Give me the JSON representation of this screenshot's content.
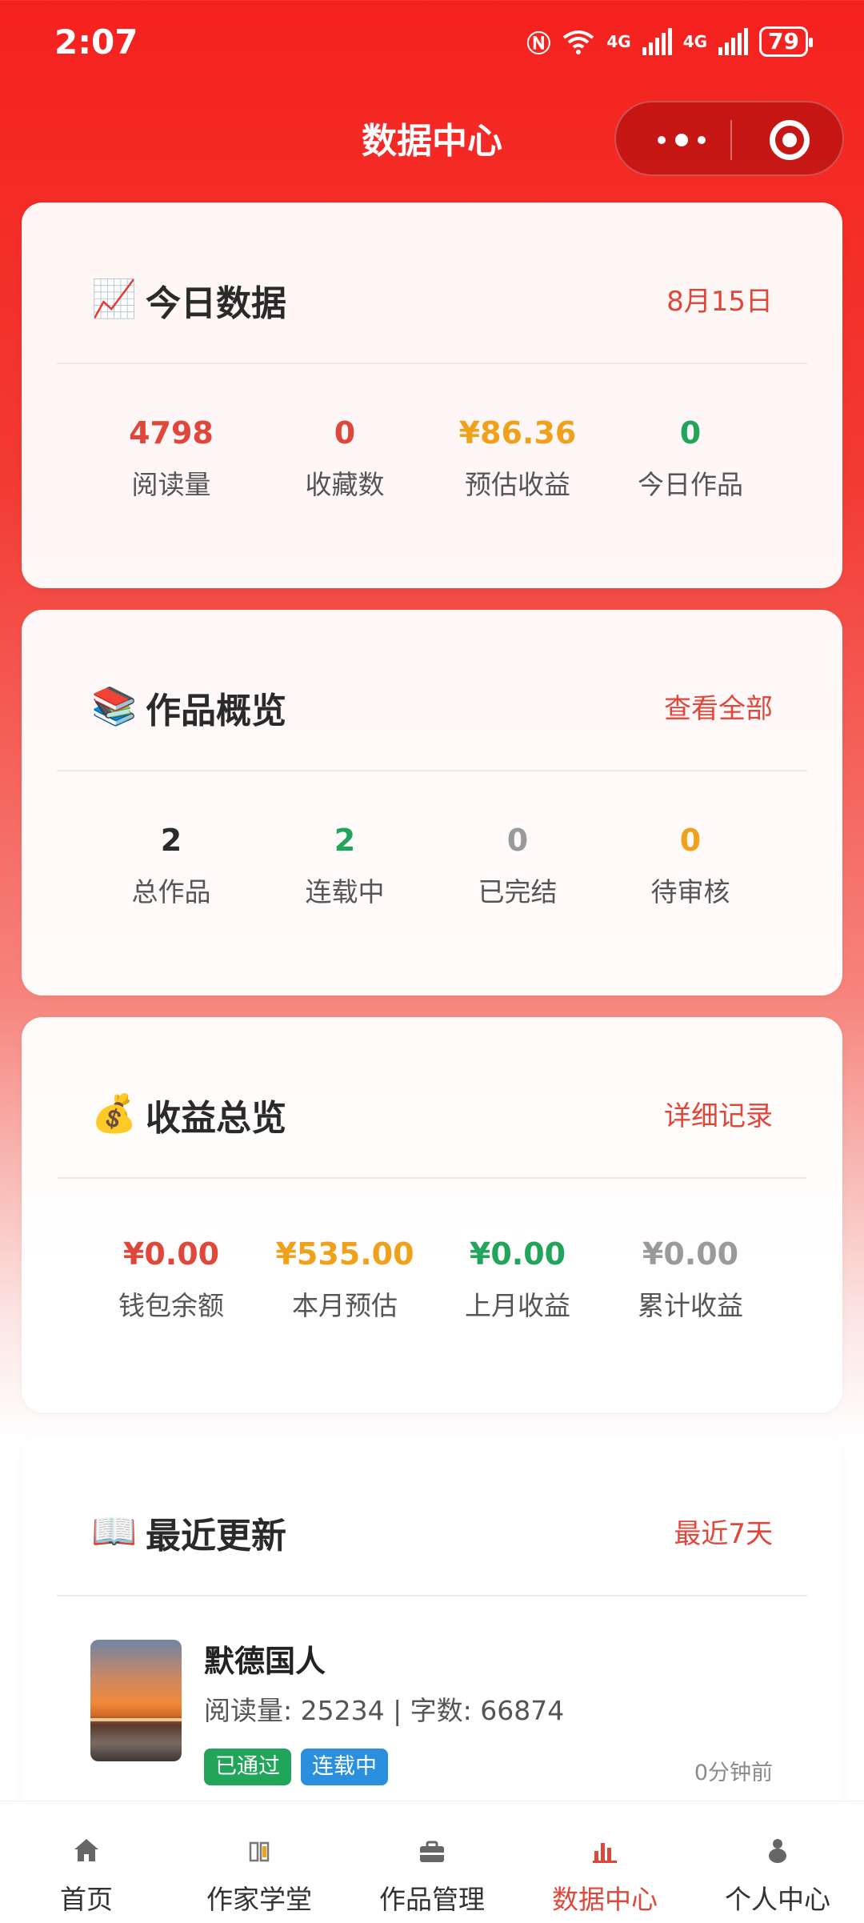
{
  "status_bar": {
    "time": "2:07",
    "network_label": "4G",
    "battery": "79"
  },
  "nav": {
    "title": "数据中心"
  },
  "today": {
    "icon": "📈",
    "title": "今日数据",
    "date": "8月15日",
    "stats": [
      {
        "value": "4798",
        "label": "阅读量",
        "color": "#e0473b"
      },
      {
        "value": "0",
        "label": "收藏数",
        "color": "#e0473b"
      },
      {
        "value": "¥86.36",
        "label": "预估收益",
        "color": "#f0a11c"
      },
      {
        "value": "0",
        "label": "今日作品",
        "color": "#21a55a"
      }
    ]
  },
  "works": {
    "icon": "📚",
    "title": "作品概览",
    "link": "查看全部",
    "stats": [
      {
        "value": "2",
        "label": "总作品",
        "color": "#2a2a2a"
      },
      {
        "value": "2",
        "label": "连载中",
        "color": "#21a55a"
      },
      {
        "value": "0",
        "label": "已完结",
        "color": "#9a9a9a"
      },
      {
        "value": "0",
        "label": "待审核",
        "color": "#f0a11c"
      }
    ]
  },
  "income": {
    "icon": "💰",
    "title": "收益总览",
    "link": "详细记录",
    "stats": [
      {
        "value": "¥0.00",
        "label": "钱包余额",
        "color": "#e0473b"
      },
      {
        "value": "¥535.00",
        "label": "本月预估",
        "color": "#f0a11c"
      },
      {
        "value": "¥0.00",
        "label": "上月收益",
        "color": "#21a55a"
      },
      {
        "value": "¥0.00",
        "label": "累计收益",
        "color": "#9a9a9a"
      }
    ]
  },
  "recent": {
    "icon": "📖",
    "title": "最近更新",
    "link": "最近7天",
    "items": [
      {
        "title": "默德国人",
        "meta": "阅读量: 25234 | 字数: 66874",
        "tags": [
          "已通过",
          "连载中"
        ],
        "time": "0分钟前"
      }
    ]
  },
  "tabbar": {
    "items": [
      {
        "label": "首页",
        "icon": "home-icon"
      },
      {
        "label": "作家学堂",
        "icon": "book-icon"
      },
      {
        "label": "作品管理",
        "icon": "briefcase-icon"
      },
      {
        "label": "数据中心",
        "icon": "bar-chart-icon",
        "active": true
      },
      {
        "label": "个人中心",
        "icon": "user-icon"
      }
    ]
  }
}
